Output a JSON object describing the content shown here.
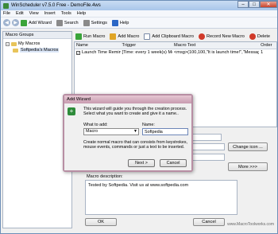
{
  "window": {
    "title": "WinScheduler v7.5.0 Free - DemoFile.4ws",
    "minimize": "–",
    "maximize": "□",
    "close": "✕"
  },
  "menu": [
    "File",
    "Edit",
    "View",
    "Insert",
    "Tools",
    "Help"
  ],
  "toolbar": {
    "add_wizard": "Add Wizard",
    "search": "Search",
    "settings": "Settings",
    "help": "Help"
  },
  "left_pane": {
    "header": "Macro Groups",
    "root": "My Macros",
    "child": "Softpedia's Macros"
  },
  "macro_toolbar": {
    "run": "Run Macro",
    "add": "Add Macro",
    "add_clipboard": "Add Clipboard Macro",
    "record": "Record New Macro",
    "delete": "Delete"
  },
  "grid": {
    "columns": [
      "Name",
      "Trigger",
      "Macro Text",
      "Order"
    ],
    "rows": [
      [
        "Launch Time Reminder",
        "[Time: every 1 week(s) Mo,T...",
        "<msg>(100,100,\"It is launch time!\",\"Message\",1,0...",
        "1"
      ]
    ]
  },
  "lower": {
    "change_icon": "Change icon ...",
    "more": "More >>>",
    "desc_label": "Macro description:",
    "desc_text": "Tested by Softpedia. Visit us at www.softpedia.com",
    "ok": "OK",
    "cancel": "Cancel",
    "watermark": "www.MacroToolworks.com"
  },
  "dialog": {
    "title": "Add Wizard",
    "intro": "This wizard will guide you through the creation process.  Select what you want to create and give it a name..",
    "what_label": "What to add:",
    "what_value": "Macro",
    "name_label": "Name:",
    "name_value": "Softpedia",
    "description": "Create normal macro that can consists from  keystrokes, mouse events, commands or just a text to be inserted.",
    "next": "Next >",
    "cancel": "Cancel"
  }
}
